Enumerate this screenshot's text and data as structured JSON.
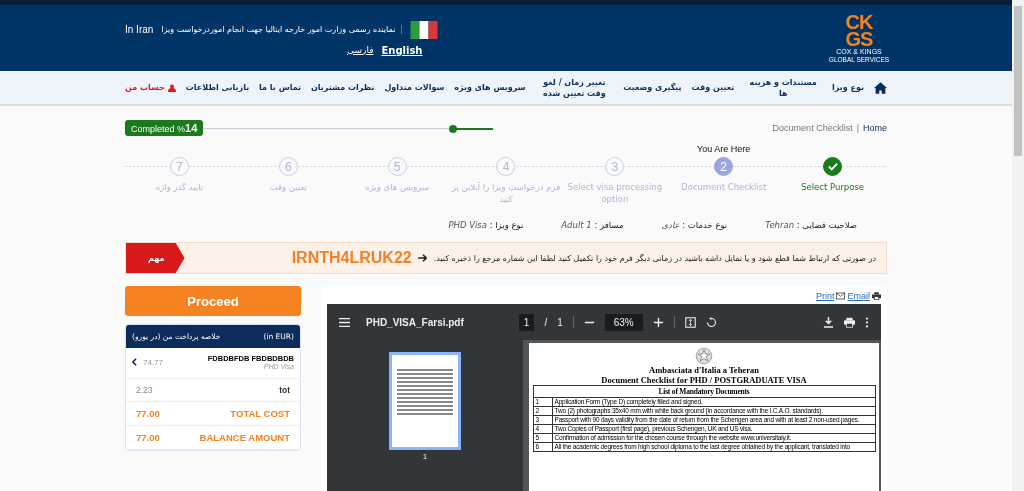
{
  "header": {
    "logo": {
      "letters_top": "CK",
      "letters_bottom": "GS",
      "name": "COX & KINGS",
      "subname": "GLOBAL SERVICES"
    },
    "tagline": "نماینده رسمی وزارت امور خارجه ایتالیا جهت انجام اموردرخواست ویزا",
    "location": "In Iran",
    "languages": [
      {
        "label": "English",
        "selected": true
      },
      {
        "label": "فارسی",
        "selected": false
      }
    ]
  },
  "nav": [
    {
      "kind": "home"
    },
    {
      "kind": "link",
      "label": "نوع ویزا"
    },
    {
      "kind": "link",
      "label": "مستندات و هزینه ها"
    },
    {
      "kind": "link",
      "label": "تعیین وقت"
    },
    {
      "kind": "link",
      "label": "پیگیری وضعیت"
    },
    {
      "kind": "link",
      "label": "تغییر زمان / لغو وقت تعیین شده"
    },
    {
      "kind": "link",
      "label": "سرویس های ویژه"
    },
    {
      "kind": "link",
      "label": "سوالات متداول"
    },
    {
      "kind": "link",
      "label": "نظرات مشتریان"
    },
    {
      "kind": "link",
      "label": "تماس با ما"
    },
    {
      "kind": "link",
      "label": "بازیابی اطلاعات"
    },
    {
      "kind": "account",
      "label": "حساب من"
    }
  ],
  "breadcrumb": {
    "items": [
      "Home",
      "Document Checklist"
    ],
    "separator": "|"
  },
  "progress": {
    "label": "Completed %",
    "percent": "14",
    "level": 0.14
  },
  "you_are_here": "You Are Here",
  "steps": [
    {
      "done": true,
      "selected": false,
      "label": "Select Purpose"
    },
    {
      "done": false,
      "selected": true,
      "number": "2",
      "label": "Document Checklist"
    },
    {
      "done": false,
      "selected": false,
      "number": "3",
      "label": "Select visa processing option"
    },
    {
      "done": false,
      "selected": false,
      "number": "4",
      "label": "فرم درخواست ویزا را آنلاین پر کنید"
    },
    {
      "done": false,
      "selected": false,
      "number": "5",
      "label": "سرویس های ویژه"
    },
    {
      "done": false,
      "selected": false,
      "number": "6",
      "label": "تعیین وقت"
    },
    {
      "done": false,
      "selected": false,
      "number": "7",
      "label": "تایید گذر واژه"
    }
  ],
  "info": [
    {
      "label": "صلاحیت قضایی :",
      "value": "Tehran"
    },
    {
      "label": "نوع خدمات :",
      "value": "عادی"
    },
    {
      "label": "مسافر :",
      "value": "Adult 1"
    },
    {
      "label": "نوع ویزا :",
      "value": "PHD Visa"
    }
  ],
  "notice": {
    "badge": "مهم",
    "code": "IRNTH4LRUK22",
    "text": "در صورتی که ارتباط شما قطع شود و یا تمایل داشه باشید در زمانی دیگر فرم خود را تکمیل کنید لطفا این شماره مرجع را ذخیره کنید."
  },
  "proceed": "Proceed",
  "summary": {
    "title": "خلاصه پرداخت من (در یورو)",
    "currency": "(in EUR)",
    "item": {
      "name": "FDBDBFDB FBDBDBDB",
      "sub": "PHD Visa",
      "amount": "74.77"
    },
    "rows": [
      {
        "kind": "plain",
        "label": "tot",
        "amount": "2.23"
      },
      {
        "kind": "total",
        "label": "TOTAL COST",
        "amount": "77.00"
      },
      {
        "kind": "total",
        "label": "BALANCE AMOUNT",
        "amount": "77.00"
      }
    ]
  },
  "document": {
    "print_link": "Print",
    "email_link": "Email",
    "viewer": {
      "filename": "PHD_VISA_Farsi.pdf",
      "page": "1",
      "separator": "/",
      "pages": "1",
      "zoom": "63%",
      "thumb_label": "1"
    },
    "title": "Ambasciata d'Italia a Teheran",
    "subtitle": "Document Checklist for PHD / POSTGRADUATE VISA",
    "table_heading": "List of Mandatory Documents",
    "rows": [
      {
        "n": "1",
        "text": "Application Form (Type D) completely filled and signed."
      },
      {
        "n": "2",
        "text": "Two (2) photographs 35x40 mm with white back ground (in accordance with the I.C.A.O. standards)."
      },
      {
        "n": "3",
        "text": "Passport with 90 days validity from the date of return from the Schengen area and with at least 2 non-used pages."
      },
      {
        "n": "4",
        "text": "Two Copies of Passport (first page), previous Schengen, UK and US visa."
      },
      {
        "n": "5",
        "text": "Confirmation of admission for the chosen course through the website www.universitaly.it."
      },
      {
        "n": "6",
        "text": "All the academic degrees from high school diploma to the last degree obtained by the applicant, translated into"
      }
    ]
  }
}
